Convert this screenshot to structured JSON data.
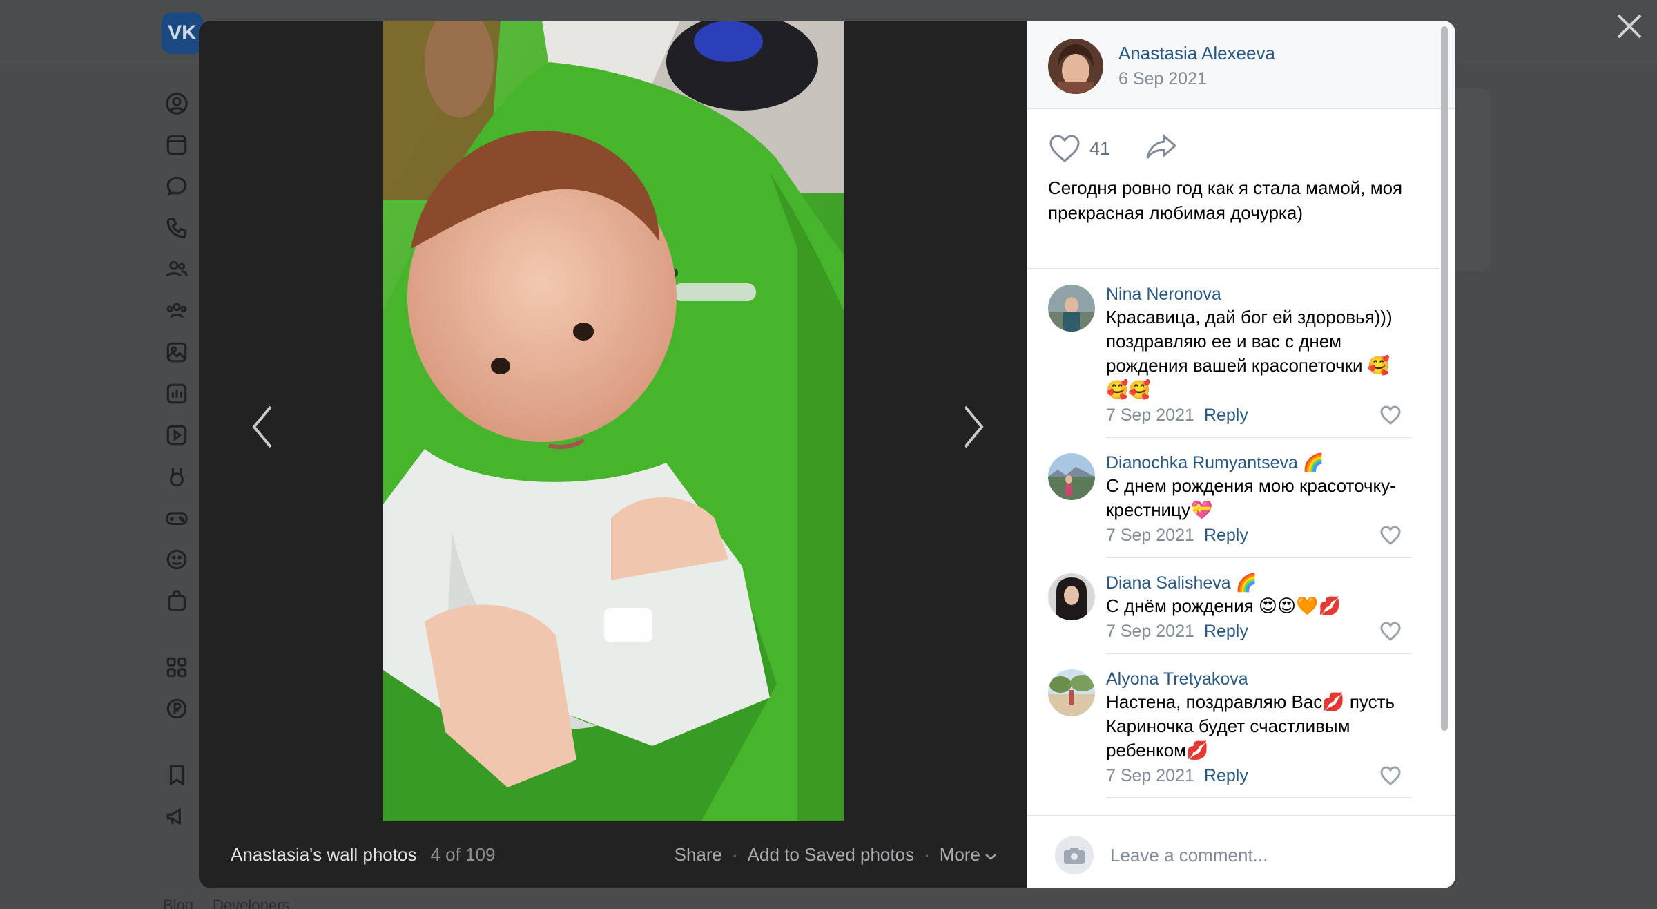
{
  "background": {
    "logo_text": "VK",
    "footer_links": [
      "Blog",
      "Developers"
    ]
  },
  "viewer": {
    "close_icon": "close-icon",
    "prev_icon": "chevron-left-icon",
    "next_icon": "chevron-right-icon",
    "album_title": "Anastasia's wall photos",
    "counter": "4 of 109",
    "actions": {
      "share": "Share",
      "save": "Add to Saved photos",
      "more": "More"
    }
  },
  "post": {
    "author": "Anastasia Alexeeva",
    "date": "6 Sep 2021",
    "likes": "41",
    "text": "Сегодня ровно год как я стала мамой, моя прекрасная любимая дочурка)"
  },
  "comments": [
    {
      "author": "Nina Neronova",
      "text": "Красавица, дай бог ей здоровья))) поздравляю ее и вас с днем рождения вашей красопеточки 🥰🥰🥰",
      "date": "7 Sep 2021",
      "reply": "Reply"
    },
    {
      "author": "Dianochka Rumyantseva 🌈",
      "text": "С днем рождения мою красоточку-крестницу💝",
      "date": "7 Sep 2021",
      "reply": "Reply"
    },
    {
      "author": "Diana Salisheva 🌈",
      "text": "С днём рождения 😍😍🧡💋",
      "date": "7 Sep 2021",
      "reply": "Reply"
    },
    {
      "author": "Alyona Tretyakova",
      "text": "Настена, поздравляю Вас💋 пусть Кариночка будет счастливым ребенком💋",
      "date": "7 Sep 2021",
      "reply": "Reply"
    }
  ],
  "comment_box": {
    "placeholder": "Leave a comment..."
  },
  "colors": {
    "link": "#2a5885",
    "muted": "#818c99",
    "photo_bg": "#222223",
    "overlay": "#4a4b4d"
  }
}
